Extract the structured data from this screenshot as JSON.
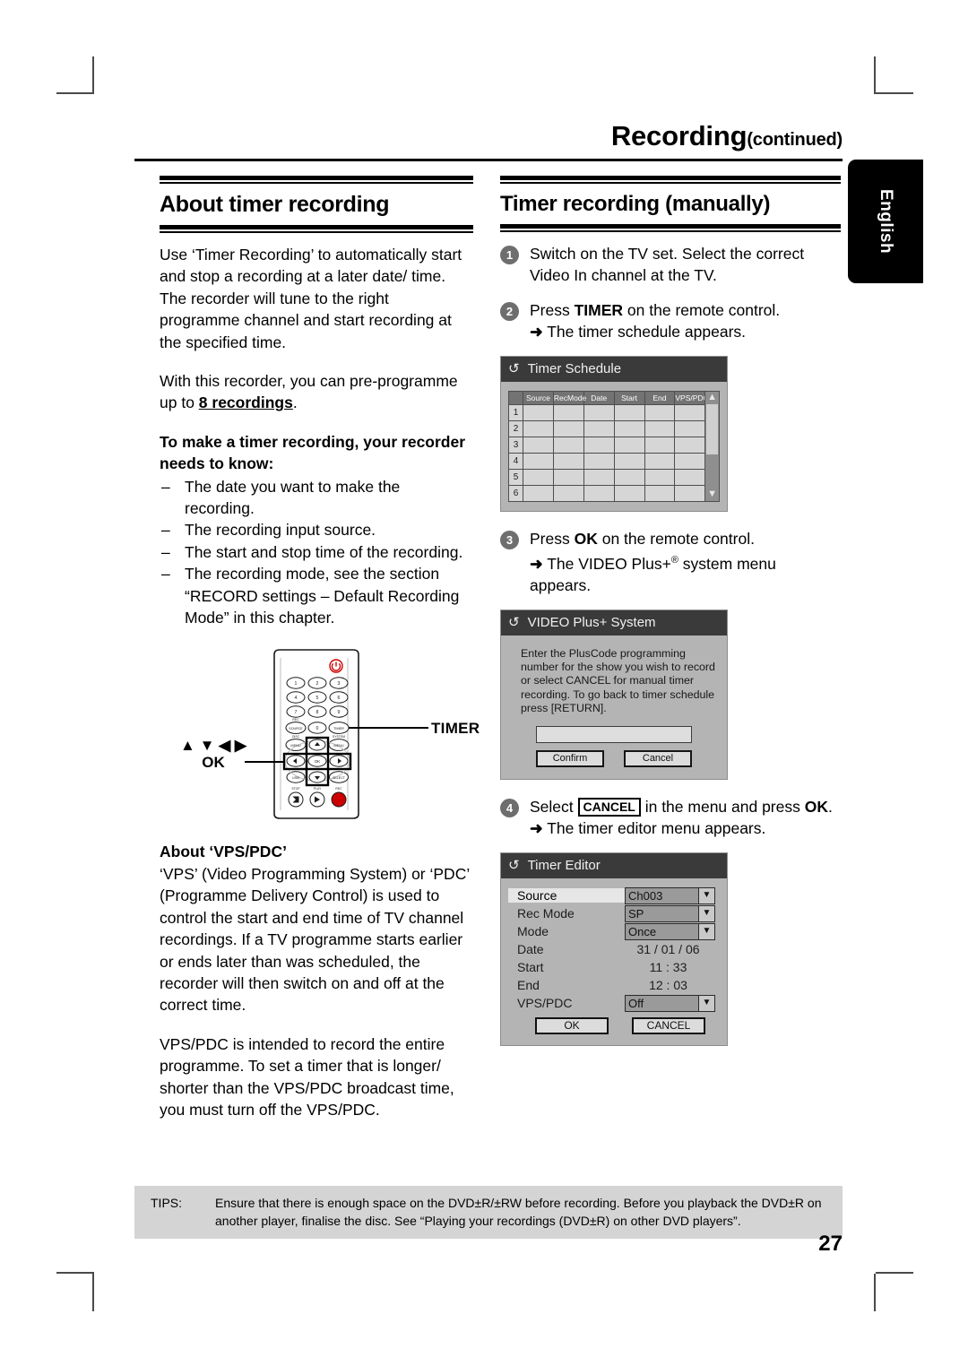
{
  "header": {
    "title": "Recording",
    "title_suffix": "(continued)",
    "language_tab": "English"
  },
  "left_column": {
    "section_title": "About timer recording",
    "paragraph_1": "Use ‘Timer Recording’ to automatically start and stop a recording at a later date/ time. The recorder will tune to the right programme channel and start recording at the specified time.",
    "paragraph_2_pre": "With this recorder, you can pre-programme up to ",
    "paragraph_2_bold": "8 recordings",
    "paragraph_2_post": ".",
    "subheading": "To make a timer recording, your recorder needs to know:",
    "bullets": [
      "The date you want to make the recording.",
      "The recording input source.",
      "The start and stop time of the recording.",
      "The recording mode, see the section “RECORD settings – Default Recording Mode” in this chapter."
    ],
    "remote": {
      "timer_callout": "TIMER",
      "nav_callout_arrows": "▲ ▼ ◀ ▶",
      "nav_callout_ok": "OK",
      "keys": [
        "1",
        "2",
        "3",
        "4",
        "5",
        "6",
        "7",
        "8",
        "9"
      ],
      "key_zero": "0",
      "key_source": "SOURCE",
      "key_source_top": "REC",
      "key_timer": "TIMER",
      "key_disc_menu": "MENU",
      "key_disc_top": "DISC",
      "key_system_menu": "MENU",
      "key_system_top": "SYSTEM",
      "key_usb": "USB",
      "key_select": "SELECT",
      "key_stop_top": "STOP",
      "key_play_top": "PLAY",
      "key_rec_top": "REC",
      "key_ok": "OK"
    },
    "vps_heading": "About ‘VPS/PDC’",
    "vps_paragraph_1": "‘VPS’ (Video Programming System) or ‘PDC’ (Programme Delivery Control) is used to control the start and end time of TV channel recordings. If a TV programme starts earlier or ends later than was scheduled, the recorder will then switch on and off at the correct time.",
    "vps_paragraph_2": "VPS/PDC is intended to record the entire programme. To set a timer that is longer/ shorter than the VPS/PDC broadcast time, you must turn off the VPS/PDC."
  },
  "right_column": {
    "section_title": "Timer recording (manually)",
    "steps": [
      {
        "num": "1",
        "text": "Switch on the TV set. Select the correct Video In channel at the TV.",
        "result": ""
      },
      {
        "num": "2",
        "text_pre": "Press ",
        "text_bold": "TIMER",
        "text_post": " on the remote control.",
        "result": "The timer schedule appears."
      },
      {
        "num": "3",
        "text_pre": "Press ",
        "text_bold": "OK",
        "text_post": " on the remote control.",
        "result_pre": "The VIDEO Plus+",
        "result_sup": "®",
        "result_post": " system menu appears."
      },
      {
        "num": "4",
        "text_pre": "Select ",
        "text_box": "CANCEL",
        "text_mid": " in the menu and press ",
        "text_bold": "OK",
        "text_post": ".",
        "result": "The timer editor menu appears."
      }
    ],
    "timer_schedule": {
      "title": "Timer Schedule",
      "columns": [
        "Source",
        "RecMode",
        "Date",
        "Start",
        "End",
        "VPS/PDC"
      ],
      "rows": [
        "1",
        "2",
        "3",
        "4",
        "5",
        "6"
      ],
      "scroll_up": "▲",
      "scroll_down": "▼"
    },
    "videoplus": {
      "title": "VIDEO Plus+ System",
      "body": "Enter the PlusCode programming number for the show you wish to record or select CANCEL for manual timer recording. To go back to timer schedule press [RETURN].",
      "input_value": "",
      "confirm_label": "Confirm",
      "cancel_label": "Cancel"
    },
    "timer_editor": {
      "title": "Timer Editor",
      "fields": [
        {
          "label": "Source",
          "value": "Ch003",
          "type": "dropdown",
          "selected": true
        },
        {
          "label": "Rec Mode",
          "value": "SP",
          "type": "dropdown",
          "selected": false
        },
        {
          "label": "Mode",
          "value": "Once",
          "type": "dropdown",
          "selected": false
        },
        {
          "label": "Date",
          "value": "31 / 01 / 06",
          "type": "plain",
          "selected": false
        },
        {
          "label": "Start",
          "value": "11 : 33",
          "type": "plain",
          "selected": false
        },
        {
          "label": "End",
          "value": "12 : 03",
          "type": "plain",
          "selected": false
        },
        {
          "label": "VPS/PDC",
          "value": "Off",
          "type": "dropdown",
          "selected": false
        }
      ],
      "ok_label": "OK",
      "cancel_label": "CANCEL",
      "caret": "▼"
    }
  },
  "tips": {
    "label": "TIPS:",
    "body": "Ensure that there is enough space on the DVD±R/±RW before recording. Before you playback the DVD±R on another player, finalise the disc. See “Playing your recordings (DVD±R) on other DVD players”."
  },
  "page_number": "27",
  "colors": {
    "osd_title_bar": "#3a3a3a",
    "osd_body": "#b4b4b4",
    "tips_bg": "#d4d4d4",
    "step_badge": "#6e6e6e",
    "power_button": "#cc0000"
  }
}
